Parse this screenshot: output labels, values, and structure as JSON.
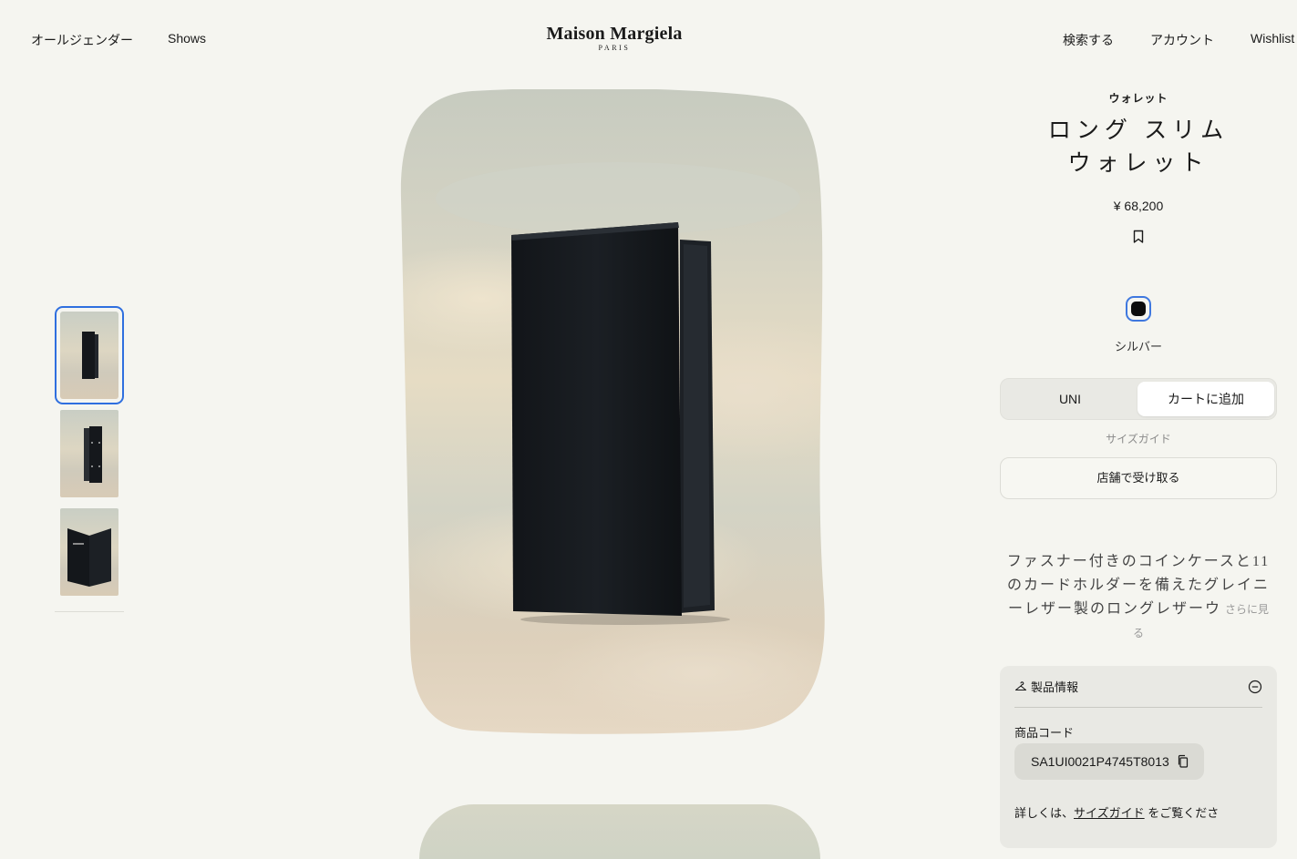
{
  "header": {
    "nav_left": [
      "オールジェンダー",
      "Shows"
    ],
    "logo": {
      "name": "Maison Margiela",
      "sub": "PARIS"
    },
    "nav_right": [
      "検索する",
      "アカウント",
      "Wishlist"
    ]
  },
  "product": {
    "category": "ウォレット",
    "title_line1": "ロング スリム",
    "title_line2": "ウォレット",
    "price": "¥ 68,200",
    "color": {
      "name": "シルバー",
      "swatch": "#0c0c0c"
    },
    "size": "UNI",
    "add_to_cart": "カートに追加",
    "size_guide": "サイズガイド",
    "pickup": "店舗で受け取る",
    "description": "ファスナー付きのコインケースと11のカードホルダーを備えたグレイニーレザー製のロングレザーウ",
    "description_more": "さらに見る"
  },
  "info": {
    "heading": "製品情報",
    "code_label": "商品コード",
    "code": "SA1UI0021P4745T8013",
    "detail_prefix": "詳しくは、",
    "detail_link": "サイズガイド",
    "detail_suffix": "をご覧くださ"
  },
  "colors": {
    "accent": "#2f6fdf",
    "background": "#f5f5f0"
  }
}
